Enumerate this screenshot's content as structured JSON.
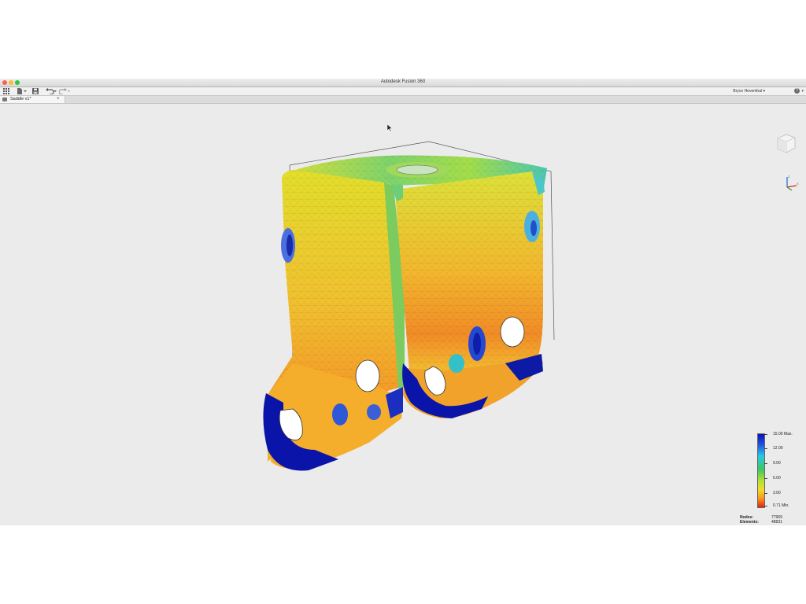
{
  "window": {
    "title": "Autodesk Fusion 360",
    "traffic_lights": [
      "#ff5f57",
      "#febc2e",
      "#28c840"
    ]
  },
  "toolbar": {
    "icons": [
      "apps-grid-icon",
      "file-icon",
      "save-icon",
      "undo-icon",
      "redo-icon"
    ],
    "user_name": "Bryce Heventhal ▾",
    "help_label": "?"
  },
  "tab": {
    "label": "Saddle v1*",
    "close": "×"
  },
  "legend": {
    "labels": [
      "15.00 Max.",
      "12.00",
      "9.00",
      "6.00",
      "3.00",
      "0.71 Min."
    ],
    "colors": [
      "#0a14b4",
      "#28c8e6",
      "#3cc864",
      "#f0dc28",
      "#fa961e",
      "#e61e14"
    ]
  },
  "mesh_stats": {
    "nodes_label": "Nodes:",
    "nodes_value": "77969",
    "elements_label": "Elements:",
    "elements_value": "48831"
  }
}
